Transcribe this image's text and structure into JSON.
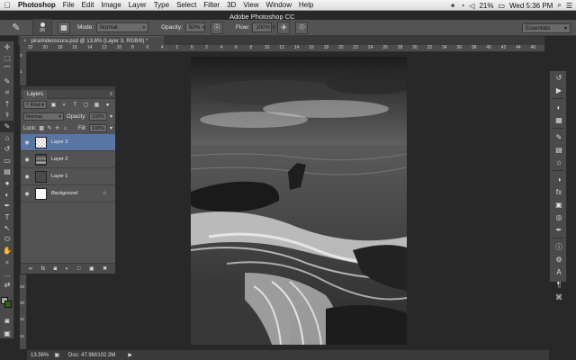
{
  "menubar": {
    "apple": "",
    "items": [
      "Photoshop",
      "File",
      "Edit",
      "Image",
      "Layer",
      "Type",
      "Select",
      "Filter",
      "3D",
      "View",
      "Window",
      "Help"
    ],
    "app_title": "Adobe Photoshop CC",
    "battery": "21%",
    "clock": "Wed 5:36 PM"
  },
  "options": {
    "brush_size": "95",
    "mode_label": "Mode:",
    "mode_value": "Normal",
    "opacity_label": "Opacity:",
    "opacity_value": "50%",
    "flow_label": "Flow:",
    "flow_value": "100%",
    "workspace": "Essentials"
  },
  "document": {
    "tab_title": "piramideoscura.psd @ 13.6% (Layer 3, RGB/8) *"
  },
  "ruler": {
    "top": [
      "22",
      "20",
      "18",
      "16",
      "14",
      "12",
      "10",
      "8",
      "6",
      "4",
      "2",
      "0",
      "2",
      "4",
      "6",
      "8",
      "10",
      "12",
      "14",
      "16",
      "18",
      "20",
      "22",
      "24",
      "26",
      "28",
      "30",
      "32",
      "34",
      "36",
      "38",
      "40",
      "42",
      "44",
      "46"
    ],
    "left": [
      "0",
      "2",
      "4",
      "6",
      "8",
      "10",
      "12",
      "14",
      "16",
      "18",
      "20",
      "22",
      "24",
      "26",
      "28",
      "30",
      "32",
      "34"
    ]
  },
  "layers_panel": {
    "tab": "Layers",
    "kind_label": "Kind",
    "blend_mode": "Normal",
    "opacity_label": "Opacity:",
    "opacity_value": "100%",
    "lock_label": "Lock:",
    "fill_label": "Fill:",
    "fill_value": "100%",
    "layers": [
      {
        "name": "Layer 3",
        "selected": true
      },
      {
        "name": "Layer 2",
        "selected": false
      },
      {
        "name": "Layer 1",
        "selected": false
      },
      {
        "name": "Background",
        "selected": false
      }
    ]
  },
  "statusbar": {
    "zoom": "13.56%",
    "doc": "Doc: 47.9M/102.3M"
  }
}
